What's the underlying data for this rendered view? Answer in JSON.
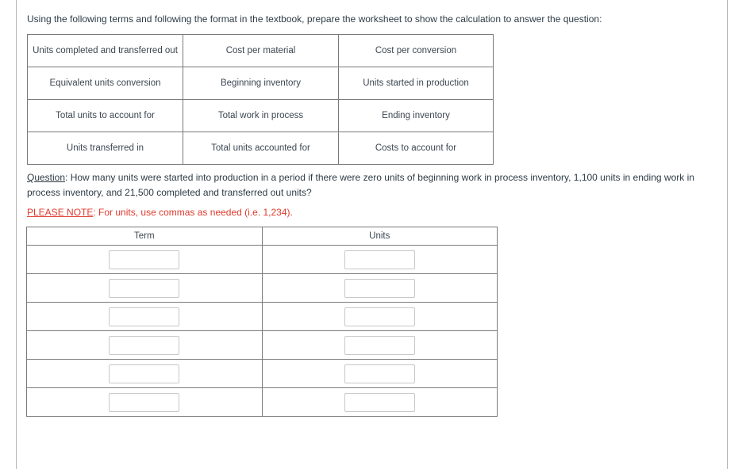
{
  "intro": "Using the following terms and following the format in the textbook, prepare the worksheet to show the calculation to answer the question:",
  "terms_table": {
    "rows": [
      [
        "Units completed and transferred out",
        "Cost per material",
        "Cost per conversion"
      ],
      [
        "Equivalent units conversion",
        "Beginning inventory",
        "Units started in production"
      ],
      [
        "Total units to account for",
        "Total work in process",
        "Ending inventory"
      ],
      [
        "Units transferred in",
        "Total units accounted for",
        "Costs to account for"
      ]
    ]
  },
  "question": {
    "label": "Question",
    "separator": ":",
    "text": " How many units were started into production in a period if there were zero units of beginning work in process inventory, 1,100 units in ending work in process inventory, and 21,500 completed and transferred out units?"
  },
  "note": {
    "label": "PLEASE NOTE",
    "separator": ":",
    "text": " For units, use commas as needed (i.e. 1,234)."
  },
  "worksheet": {
    "headers": [
      "Term",
      "Units"
    ],
    "rows": [
      {
        "term": "",
        "units": ""
      },
      {
        "term": "",
        "units": ""
      },
      {
        "term": "",
        "units": ""
      },
      {
        "term": "",
        "units": ""
      },
      {
        "term": "",
        "units": ""
      },
      {
        "term": "",
        "units": ""
      }
    ]
  },
  "colors": {
    "text": "#2d3b45",
    "note": "#e0392b",
    "border": "#2d2d2d"
  }
}
